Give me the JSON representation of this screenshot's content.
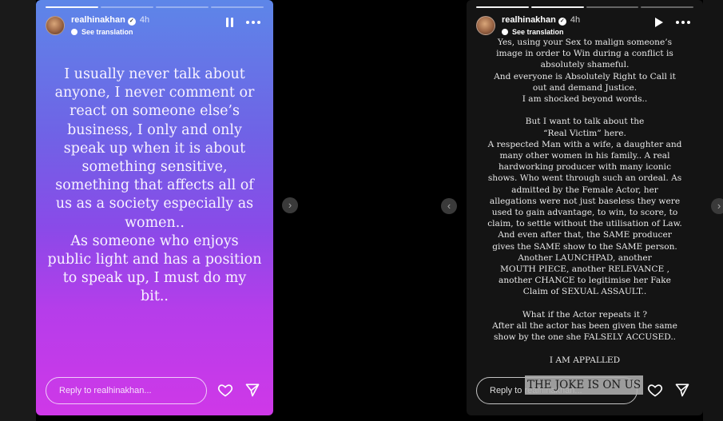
{
  "stories": [
    {
      "username": "realhinakhan",
      "verified_icon": "verified-badge-icon",
      "age": "4h",
      "translate": "See translation",
      "control_icon": "pause-icon",
      "text": "I usually never talk about\nanyone, I never comment or\nreact on someone else’s\nbusiness, I only and only\nspeak up when it is about\nsomething sensitive,\nsomething that affects all of\nus as a society especially as\nwomen..\nAs someone who enjoys\npublic light and has a position\nto speak up, I must do my bit..",
      "reply_placeholder": "Reply to realhinakhan..."
    },
    {
      "username": "realhinakhan",
      "verified_icon": "verified-badge-icon",
      "age": "4h",
      "translate": "See translation",
      "control_icon": "play-icon",
      "text": "Yes, using your Sex to malign someone’s\nimage  in order to Win during a conflict is\nabsolutely shameful.\nAnd everyone is Absolutely Right to Call it\nout and demand Justice.\nI am shocked beyond words..\n\nBut I want to talk about the\n“Real Victim” here.\nA respected Man with a wife, a daughter and\nmany other women in his family.. A real\nhardworking producer with many iconic\nshows. Who went through such an ordeal. As\nadmitted by the Female Actor, her\nallegations were not just baseless they were\nused to gain advantage, to win, to score, to\nclaim, to settle without the utilisation of Law.\nAnd even after that, the SAME producer\ngives the SAME show to the SAME  person.\nAnother LAUNCHPAD, another\nMOUTH PIECE, another RELEVANCE  ,\nanother CHANCE to legitimise her Fake\nClaim of SEXUAL ASSAULT..\n\nWhat if the Actor repeats it ?\nAfter all the actor has been given the same\nshow by the one she FALSELY ACCUSED..\n\nI AM APPALLED",
      "reply_placeholder": "Reply to realhinakhan...",
      "overlay": "THE JOKE IS ON US"
    }
  ],
  "nav": {
    "prev": "‹",
    "next": "›"
  },
  "colors": {
    "gradient_top": "#5d86e8",
    "gradient_bottom": "#cf38e8",
    "dark_story": "#141414"
  }
}
